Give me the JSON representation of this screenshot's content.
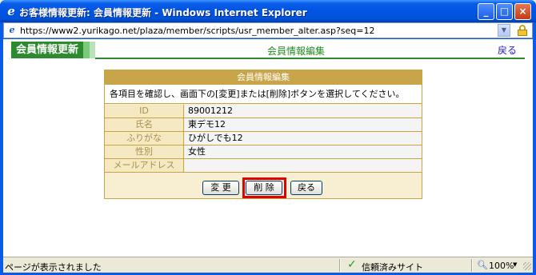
{
  "window": {
    "title": "お客様情報更新: 会員情報更新 - Windows Internet Explorer",
    "minimize_glyph": "_",
    "maximize_glyph": "□",
    "close_glyph": "×",
    "ie_icon_glyph": "e"
  },
  "address_bar": {
    "url": "https://www2.yurikago.net/plaza/member/scripts/usr_member_alter.asp?seq=12"
  },
  "header": {
    "section_label": "会員情報更新",
    "page_title": "会員情報編集",
    "back_link": "戻る"
  },
  "panel": {
    "heading": "会員情報編集",
    "instruction": "各項目を確認し、画面下の[変更]または[削除]ボタンを選択してください。",
    "rows": [
      {
        "label": "ID",
        "value": "89001212"
      },
      {
        "label": "氏名",
        "value": "東デモ12"
      },
      {
        "label": "ふりがな",
        "value": "ひがしでも12"
      },
      {
        "label": "性別",
        "value": "女性"
      },
      {
        "label": "メールアドレス",
        "value": ""
      }
    ],
    "buttons": {
      "change": "変 更",
      "delete": "削 除",
      "back": "戻る"
    }
  },
  "status_bar": {
    "status_text": "ページが表示されました",
    "zone_text": "信頼済みサイト",
    "zoom": "100%"
  },
  "colors": {
    "header_green": "#2e8a2e",
    "panel_gold": "#c9a54a",
    "highlight_red": "#e00000",
    "link_blue": "#2222cc"
  },
  "icons": {
    "trusted": "check-icon",
    "secure": "lock-icon",
    "zoom": "magnifier-icon"
  }
}
